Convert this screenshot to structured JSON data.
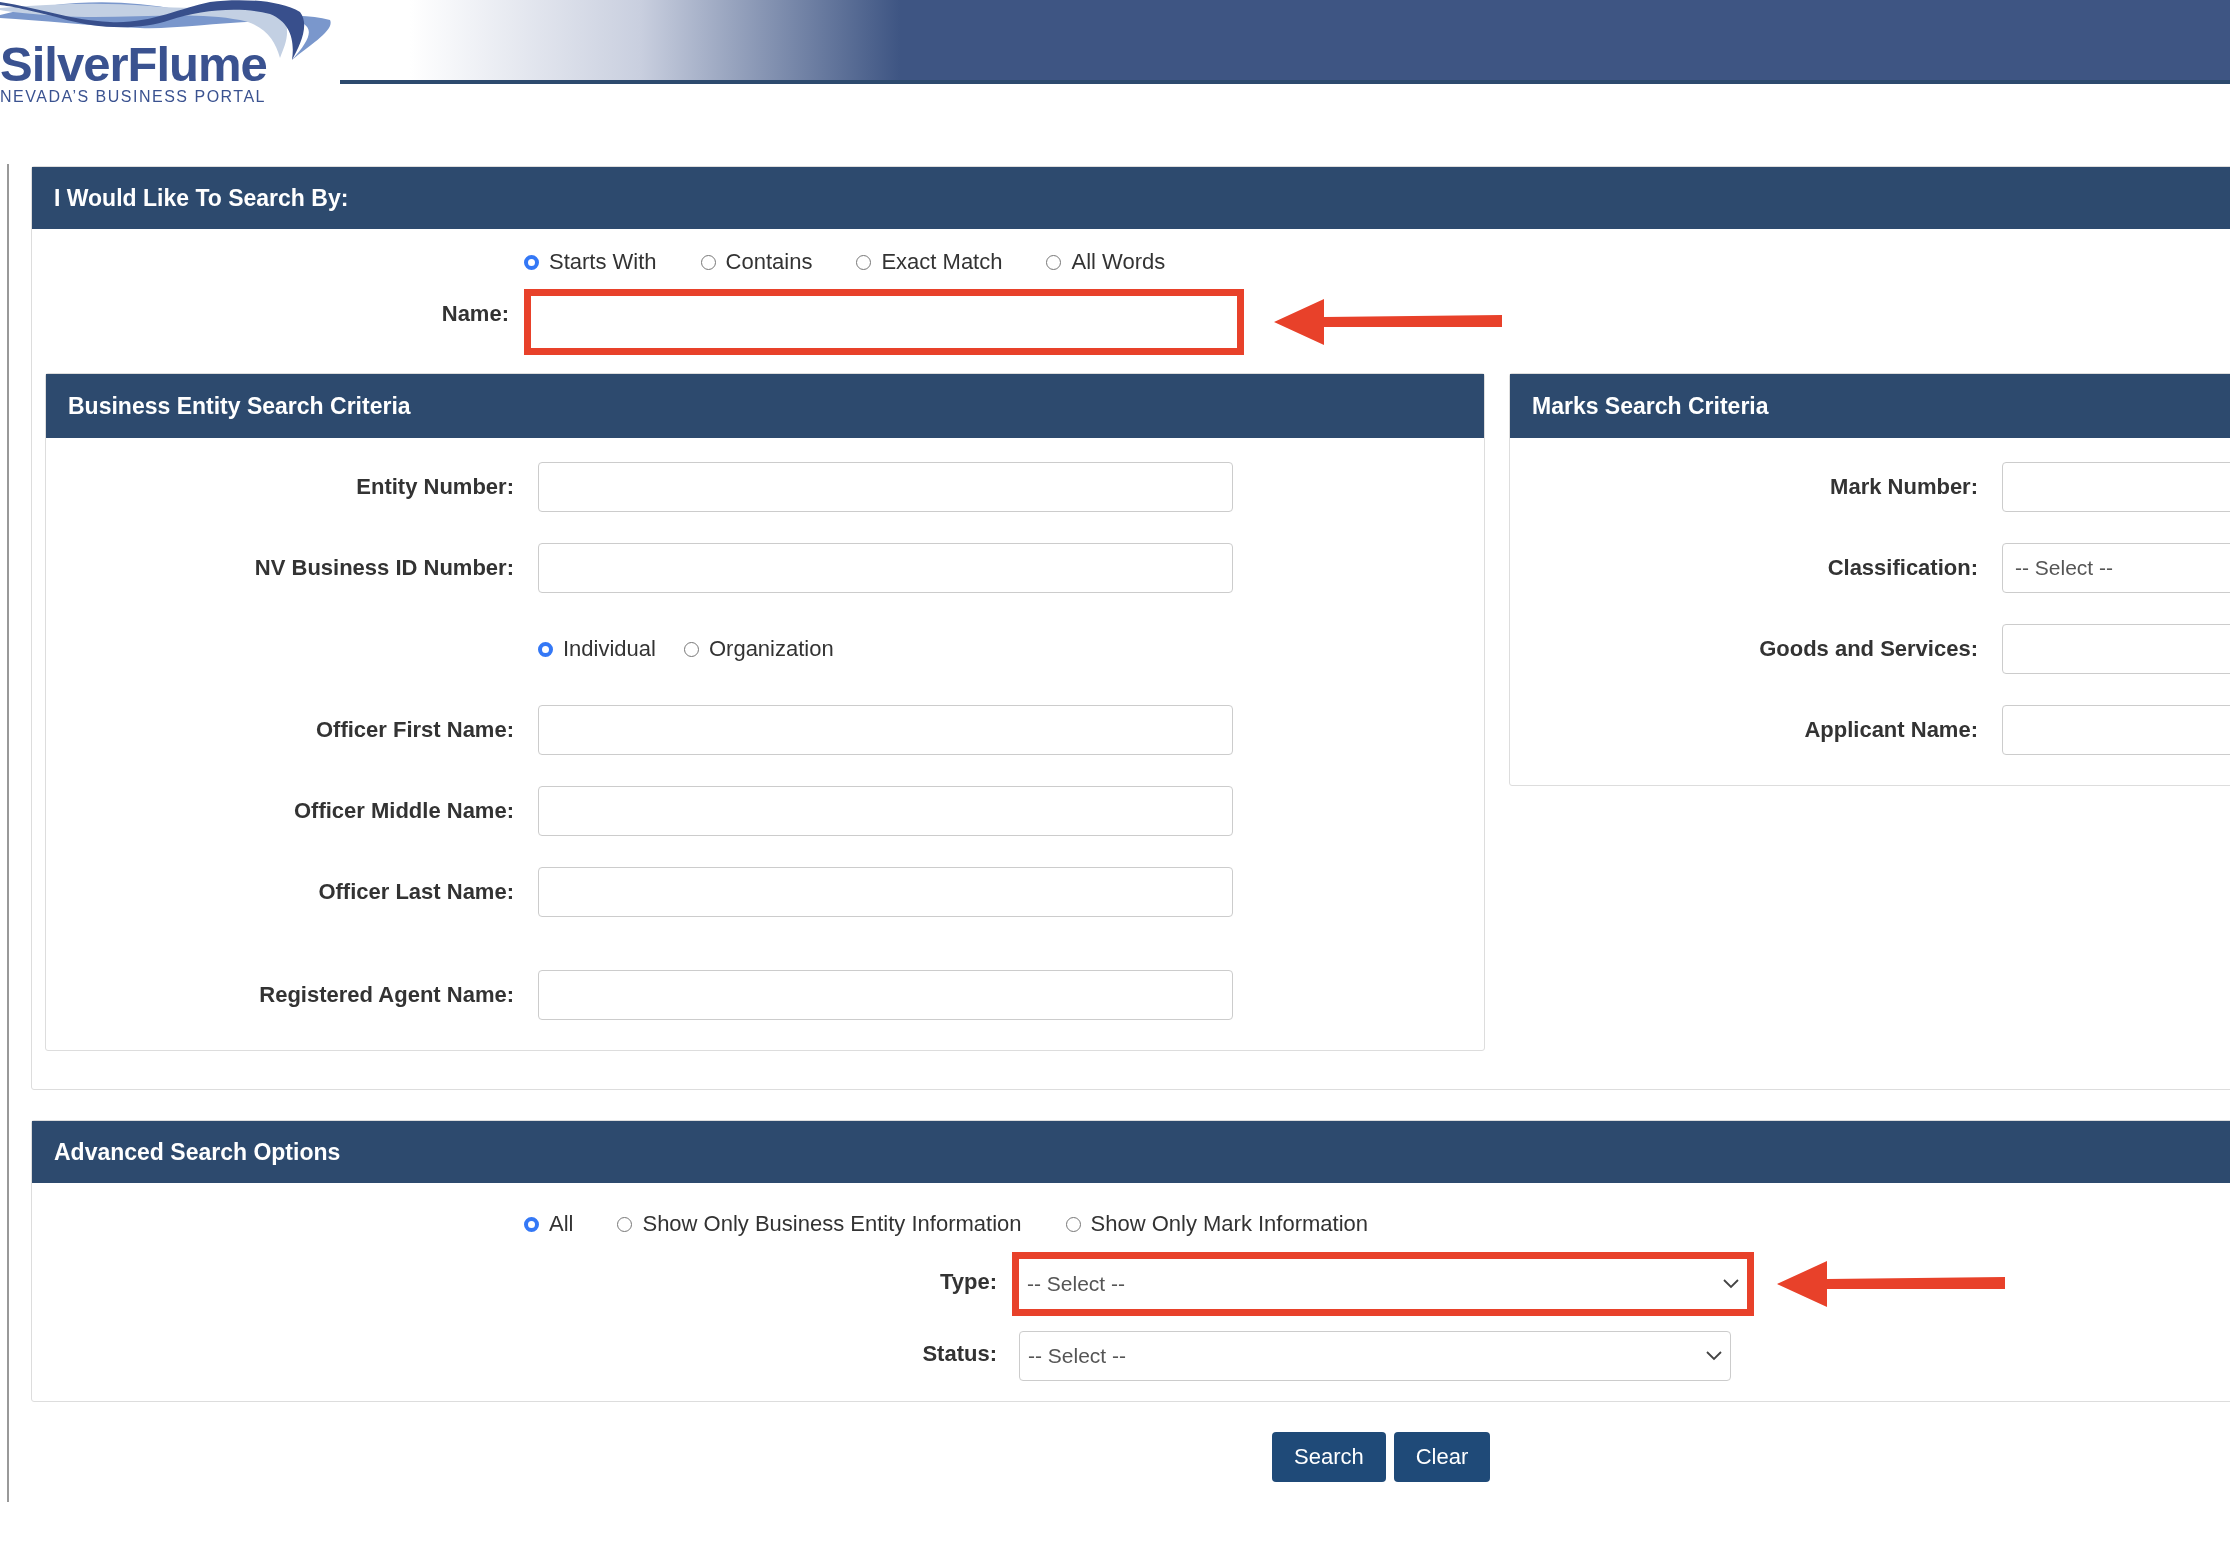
{
  "logo": {
    "name": "SilverFlume",
    "tagline": "NEVADA’S BUSINESS PORTAL"
  },
  "search_by": {
    "title": "I Would Like To Search By:",
    "match_options": [
      {
        "label": "Starts With",
        "selected": true
      },
      {
        "label": "Contains",
        "selected": false
      },
      {
        "label": "Exact Match",
        "selected": false
      },
      {
        "label": "All Words",
        "selected": false
      }
    ],
    "name_field": {
      "label": "Name:",
      "highlighted": true
    }
  },
  "business_entity": {
    "title": "Business Entity Search Criteria",
    "rows": [
      {
        "kind": "text",
        "label": "Entity Number:"
      },
      {
        "kind": "text",
        "label": "NV Business ID Number:"
      },
      {
        "kind": "radios",
        "options": [
          {
            "label": "Individual",
            "selected": true
          },
          {
            "label": "Organization",
            "selected": false
          }
        ]
      },
      {
        "kind": "text",
        "label": "Officer First Name:"
      },
      {
        "kind": "text",
        "label": "Officer Middle Name:"
      },
      {
        "kind": "text",
        "label": "Officer Last Name:"
      },
      {
        "kind": "text",
        "label": "Registered Agent Name:"
      }
    ]
  },
  "marks": {
    "title": "Marks Search Criteria",
    "rows": [
      {
        "kind": "text",
        "label": "Mark Number:"
      },
      {
        "kind": "select",
        "label": "Classification:",
        "value": "-- Select --"
      },
      {
        "kind": "text",
        "label": "Goods and Services:"
      },
      {
        "kind": "text",
        "label": "Applicant Name:"
      }
    ]
  },
  "advanced": {
    "title": "Advanced Search Options",
    "options": [
      {
        "label": "All",
        "selected": true
      },
      {
        "label": "Show Only Business Entity Information",
        "selected": false
      },
      {
        "label": "Show Only Mark Information",
        "selected": false
      }
    ],
    "fields": [
      {
        "label": "Type:",
        "value": "-- Select --",
        "highlighted": true
      },
      {
        "label": "Status:",
        "value": "-- Select --",
        "highlighted": false
      }
    ]
  },
  "buttons": [
    {
      "label": "Search"
    },
    {
      "label": "Clear"
    }
  ]
}
